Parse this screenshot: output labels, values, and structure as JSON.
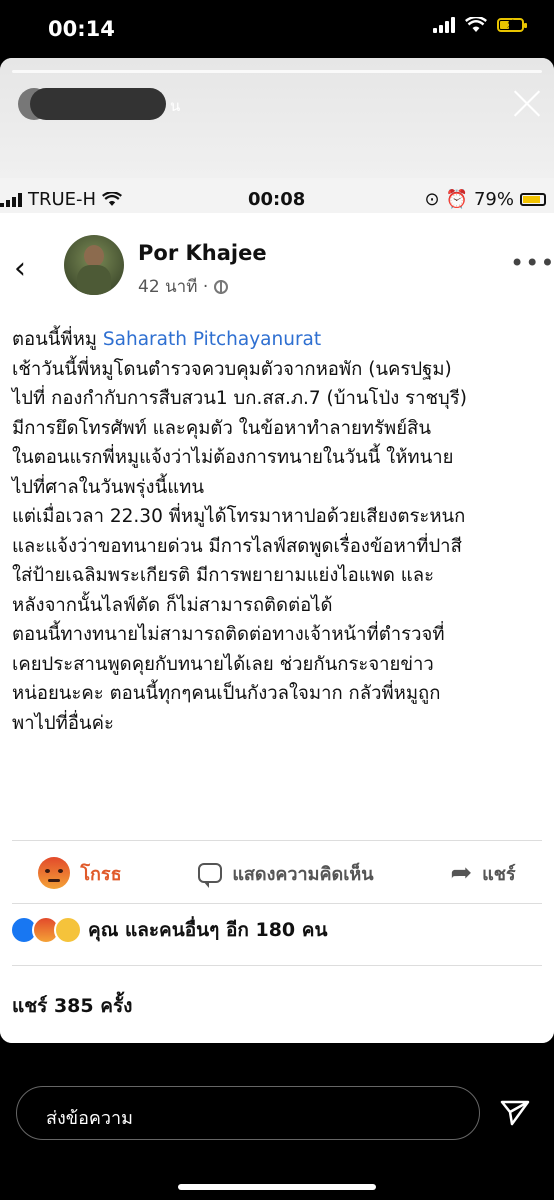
{
  "device": {
    "time": "00:14"
  },
  "story": {
    "username_suffix": "น"
  },
  "inner_status": {
    "carrier": "TRUE-H",
    "time": "00:08",
    "battery": "79%"
  },
  "post": {
    "author": "Por Khajee",
    "time_ago": "42 นาที ·",
    "lines": [
      {
        "pre": "ตอนนี้พี่หมู ",
        "mention": "Saharath Pitchayanurat"
      },
      {
        "pre": "เช้าวันนี้พี่หมูโดนตำรวจควบคุมตัวจากหอพัก (นครปฐม)"
      },
      {
        "pre": "ไปที่ กองกำกับการสืบสวน1 บก.สส.ภ.7  (บ้านโป่ง ราชบุรี)"
      },
      {
        "pre": "มีการยึดโทรศัพท์ และคุมตัว  ในข้อหาทำลายทรัพย์สิน"
      },
      {
        "pre": "ในตอนแรกพี่หมูแจ้งว่าไม่ต้องการทนายในวันนี้  ให้ทนาย"
      },
      {
        "pre": "ไปที่ศาลในวันพรุ่งนี้แทน"
      },
      {
        "pre": "แต่เมื่อเวลา 22.30 พี่หมูได้โทรมาหาปอด้วยเสียงตระหนก"
      },
      {
        "pre": "และแจ้งว่าขอทนายด่วน มีการไลฟ์สดพูดเรื่องข้อหาที่ปาสี"
      },
      {
        "pre": "ใส่ป้ายเฉลิมพระเกียรติ มีการพยายามแย่งไอแพด และ"
      },
      {
        "pre": "หลังจากนั้นไลฟ์ตัด ก็ไม่สามารถติดต่อได้"
      },
      {
        "pre": "ตอนนี้ทางทนายไม่สามารถติดต่อทางเจ้าหน้าที่ตำรวจที่"
      },
      {
        "pre": "เคยประสานพูดคุยกับทนายได้เลย  ช่วยกันกระจายข่าว"
      },
      {
        "pre": "หน่อยนะคะ  ตอนนี้ทุกๆคนเป็นกังวลใจมาก กลัวพี่หมูถูก"
      },
      {
        "pre": "พาไปที่อื่นค่ะ"
      }
    ],
    "actions": {
      "react": "โกรธ",
      "comment": "แสดงความคิดเห็น",
      "share": "แชร์"
    },
    "reactions_summary": "คุณ และคนอื่นๆ อีก 180 คน",
    "shares": "แชร์ 385 ครั้ง"
  },
  "reply": {
    "placeholder": "ส่งข้อความ"
  }
}
